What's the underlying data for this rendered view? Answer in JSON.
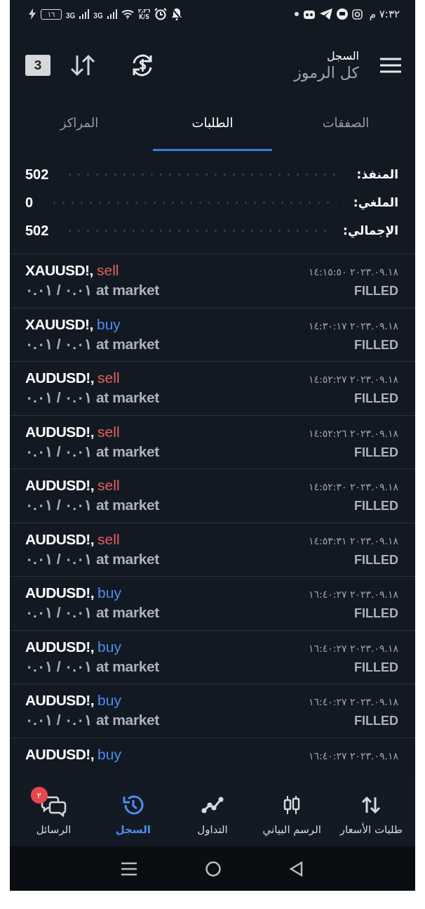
{
  "status_bar": {
    "time": "٧:٣٢ م",
    "battery": "١٦",
    "sim1_network": "3G",
    "sim2_network": "3G",
    "speed": "٢٫٢٦",
    "speed_unit": "K/S"
  },
  "header": {
    "title": "السجل",
    "subtitle": "كل الرموز",
    "calendar_day": "3"
  },
  "tabs": [
    {
      "label": "الصفقات",
      "selected": false
    },
    {
      "label": "الطلبات",
      "selected": true
    },
    {
      "label": "المراكز",
      "selected": false
    }
  ],
  "summary": [
    {
      "label": "المنفذ:",
      "value": "502"
    },
    {
      "label": "الملغي:",
      "value": "0"
    },
    {
      "label": "الإجمالي:",
      "value": "502"
    }
  ],
  "orders": [
    {
      "symbol": "XAUUSD!,",
      "side": "sell",
      "kind": "sell",
      "time": "٢٠٢٣.٠٩.١٨ ١٤:١٥:٥٠",
      "volume": "٠.٠١ / ٠.٠١",
      "type": "at market",
      "status": "FILLED"
    },
    {
      "symbol": "XAUUSD!,",
      "side": "buy",
      "kind": "buy",
      "time": "٢٠٢٣.٠٩.١٨ ١٤:٣٠:١٧",
      "volume": "٠.٠١ / ٠.٠١",
      "type": "at market",
      "status": "FILLED"
    },
    {
      "symbol": "AUDUSD!,",
      "side": "sell",
      "kind": "sell",
      "time": "٢٠٢٣.٠٩.١٨ ١٤:٥٢:٢٧",
      "volume": "٠.٠١ / ٠.٠١",
      "type": "at market",
      "status": "FILLED"
    },
    {
      "symbol": "AUDUSD!,",
      "side": "sell",
      "kind": "sell",
      "time": "٢٠٢٣.٠٩.١٨ ١٤:٥٢:٢٦",
      "volume": "٠.٠١ / ٠.٠١",
      "type": "at market",
      "status": "FILLED"
    },
    {
      "symbol": "AUDUSD!,",
      "side": "sell",
      "kind": "sell",
      "time": "٢٠٢٣.٠٩.١٨ ١٤:٥٢:٣٠",
      "volume": "٠.٠١ / ٠.٠١",
      "type": "at market",
      "status": "FILLED"
    },
    {
      "symbol": "AUDUSD!,",
      "side": "sell",
      "kind": "sell",
      "time": "٢٠٢٣.٠٩.١٨ ١٤:٥٣:٣١",
      "volume": "٠.٠١ / ٠.٠١",
      "type": "at market",
      "status": "FILLED"
    },
    {
      "symbol": "AUDUSD!,",
      "side": "buy",
      "kind": "buy",
      "time": "٢٠٢٣.٠٩.١٨ ١٦:٤٠:٢٧",
      "volume": "٠.٠١ / ٠.٠١",
      "type": "at market",
      "status": "FILLED"
    },
    {
      "symbol": "AUDUSD!,",
      "side": "buy",
      "kind": "buy",
      "time": "٢٠٢٣.٠٩.١٨ ١٦:٤٠:٢٧",
      "volume": "٠.٠١ / ٠.٠١",
      "type": "at market",
      "status": "FILLED"
    },
    {
      "symbol": "AUDUSD!,",
      "side": "buy",
      "kind": "buy",
      "time": "٢٠٢٣.٠٩.١٨ ١٦:٤٠:٢٧",
      "volume": "٠.٠١ / ٠.٠١",
      "type": "at market",
      "status": "FILLED"
    },
    {
      "symbol": "AUDUSD!,",
      "side": "buy",
      "kind": "buy",
      "time": "٢٠٢٣.٠٩.١٨ ١٦:٤٠:٢٧"
    }
  ],
  "bottom_nav": [
    {
      "label": "طلبات الأسعار",
      "kind": "quotes",
      "selected": false
    },
    {
      "label": "الرسم البياني",
      "kind": "chart",
      "selected": false
    },
    {
      "label": "التداول",
      "kind": "trade",
      "selected": false
    },
    {
      "label": "السجل",
      "kind": "history",
      "selected": true
    },
    {
      "label": "الرسائل",
      "kind": "messages",
      "selected": false,
      "badge": "٢"
    }
  ]
}
